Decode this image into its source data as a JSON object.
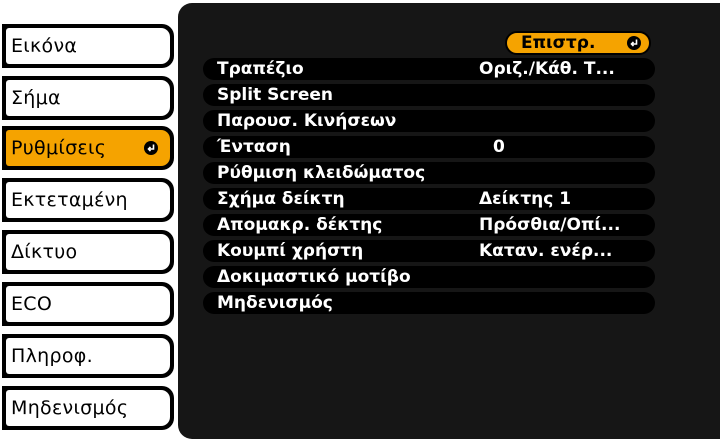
{
  "sidebar": {
    "items": [
      {
        "label": "Εικόνα",
        "selected": false
      },
      {
        "label": "Σήμα",
        "selected": false
      },
      {
        "label": "Ρυθμίσεις",
        "selected": true
      },
      {
        "label": "Εκτεταμένη",
        "selected": false
      },
      {
        "label": "Δίκτυο",
        "selected": false
      },
      {
        "label": "ECO",
        "selected": false
      },
      {
        "label": "Πληροφ.",
        "selected": false
      },
      {
        "label": "Μηδενισμός",
        "selected": false
      }
    ]
  },
  "back_button": {
    "label": "Επιστρ.",
    "icon": "enter-icon"
  },
  "settings": [
    {
      "label": "Τραπέζιο",
      "value": "Οριζ./Κάθ. Τ..."
    },
    {
      "label": "Split Screen",
      "value": ""
    },
    {
      "label": "Παρουσ. Κινήσεων",
      "value": ""
    },
    {
      "label": "Ένταση",
      "value": "0"
    },
    {
      "label": "Ρύθμιση κλειδώματος",
      "value": ""
    },
    {
      "label": "Σχήμα δείκτη",
      "value": "Δείκτης 1"
    },
    {
      "label": "Απομακρ. δέκτης",
      "value": "Πρόσθια/Οπί..."
    },
    {
      "label": "Κουμπί χρήστη",
      "value": "Καταν. ενέρ..."
    },
    {
      "label": "Δοκιμαστικό μοτίβο",
      "value": ""
    },
    {
      "label": "Μηδενισμός",
      "value": ""
    }
  ],
  "colors": {
    "accent": "#f5a300",
    "panel": "#161616",
    "row": "#000000"
  }
}
